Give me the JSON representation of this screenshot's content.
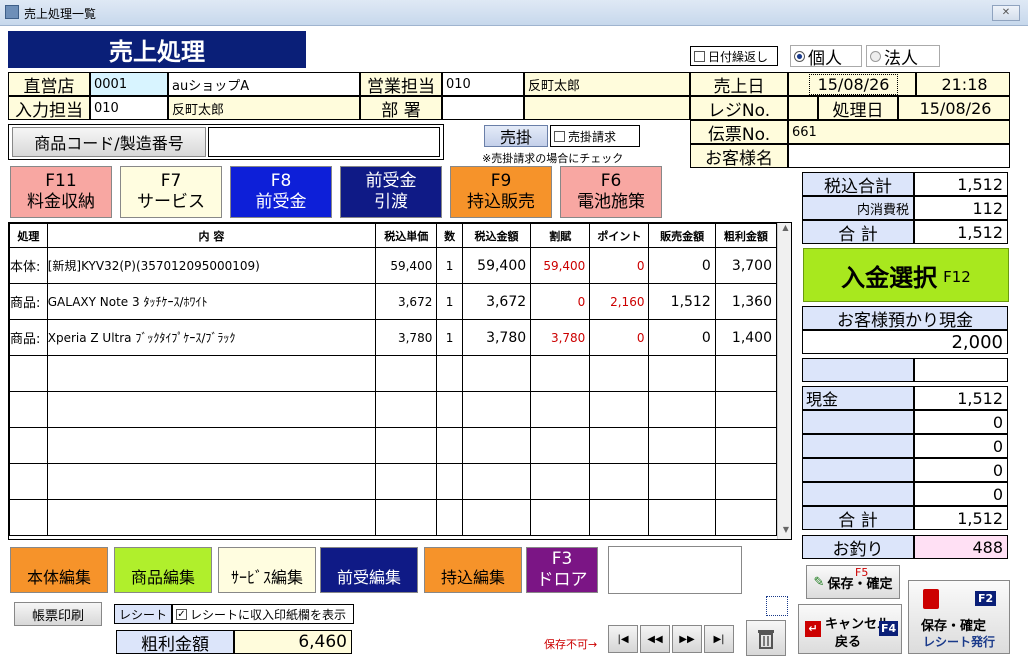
{
  "window": {
    "title": "売上処理一覧",
    "close": "✕"
  },
  "header": {
    "title": "売上処理",
    "date_repeat": "日付繰返し",
    "person": "個人",
    "corp": "法人"
  },
  "row1": {
    "store_label": "直営店",
    "store_code": "0001",
    "store_name": "auショップA",
    "sales_label": "営業担当",
    "sales_code": "010",
    "sales_name": "反町太郎",
    "date_label": "売上日",
    "date": "15/08/26",
    "time": "21:18"
  },
  "row2": {
    "input_label": "入力担当",
    "input_code": "010",
    "input_name": "反町太郎",
    "dept_label": "部 署",
    "dept_code": "",
    "dept_name": "",
    "register_label": "レジNo.",
    "register": "",
    "proc_label": "処理日",
    "proc_date": "15/08/26"
  },
  "row3": {
    "code_label": "商品コード/製造番号",
    "code_value": "",
    "credit_label": "売掛",
    "credit_check": "売掛請求",
    "credit_note": "※売掛請求の場合にチェック",
    "slip_label": "伝票No.",
    "slip": "661",
    "customer_label": "お客様名",
    "customer": ""
  },
  "fkeys": [
    {
      "key": "F11",
      "label": "料金収納"
    },
    {
      "key": "F7",
      "label": "サービス"
    },
    {
      "key": "F8",
      "label": "前受金"
    },
    {
      "key": "前受金",
      "label": "引渡"
    },
    {
      "key": "F9",
      "label": "持込販売"
    },
    {
      "key": "F6",
      "label": "電池施策"
    }
  ],
  "table": {
    "headers": [
      "処理",
      "内 容",
      "税込単価",
      "数",
      "税込金額",
      "割賦",
      "ポイント",
      "販売金額",
      "粗利金額"
    ],
    "rows": [
      [
        "本体:",
        "[新規]KYV32(P)(357012095000109)",
        "59,400",
        "1",
        "59,400",
        "59,400",
        "0",
        "0",
        "3,700"
      ],
      [
        "商品:",
        "GALAXY Note 3 ﾀｯﾁｹｰｽ/ﾎﾜｲﾄ",
        "3,672",
        "1",
        "3,672",
        "0",
        "2,160",
        "1,512",
        "1,360"
      ],
      [
        "商品:",
        "Xperia Z Ultra ﾌﾞｯｸﾀｲﾌﾟｹｰｽ/ﾌﾞﾗｯｸ",
        "3,780",
        "1",
        "3,780",
        "3,780",
        "0",
        "0",
        "1,400"
      ]
    ]
  },
  "right": {
    "total_tax_label": "税込合計",
    "total_tax": "1,512",
    "inner_tax_label": "内消費税",
    "inner_tax": "112",
    "sum_label": "合 計",
    "sum": "1,512",
    "pay_select": "入金選択",
    "pay_key": "F12",
    "deposit_label": "お客様預かり現金",
    "deposit": "2,000",
    "cash_label": "現金",
    "cash": "1,512",
    "z1": "0",
    "z2": "0",
    "z3": "0",
    "z4": "0",
    "sum2_label": "合 計",
    "sum2": "1,512",
    "change_label": "お釣り",
    "change": "488"
  },
  "bottom": {
    "btns": [
      "本体編集",
      "商品編集",
      "ｻｰﾋﾞｽ編集",
      "前受編集",
      "持込編集"
    ],
    "drawer_key": "F3",
    "drawer": "ドロア",
    "print": "帳票印刷",
    "receipt": "レシート",
    "receipt_check": "レシートに収入印紙欄を表示",
    "profit_label": "粗利金額",
    "profit": "6,460",
    "nosave": "保存不可→",
    "save_key": "F5",
    "save": "保存・確定",
    "cancel": "キャンセル",
    "back": "戻る",
    "cancel_key": "F4",
    "save2": "保存・確定",
    "save2_key": "F2",
    "save2_sub": "レシート発行"
  },
  "nav": [
    "|◀",
    "◀◀",
    "▶▶",
    "▶|"
  ]
}
